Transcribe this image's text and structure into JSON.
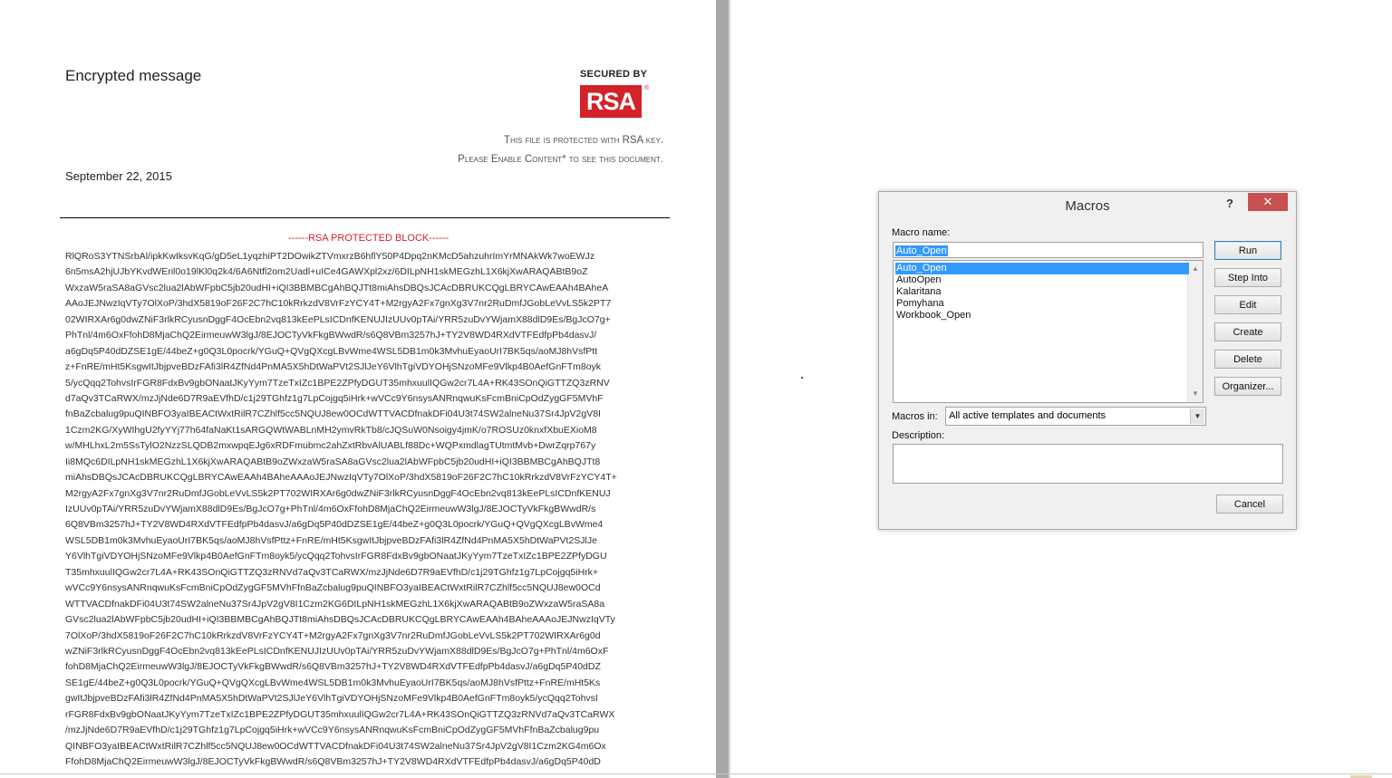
{
  "document": {
    "title": "Encrypted message",
    "secured_by": "SECURED BY",
    "logo_text": "RSA",
    "logo_reg": "®",
    "notice_line1": "This file is protected with RSA key.",
    "notice_line2": "Please Enable Content* to see this document.",
    "date": "September 22, 2015",
    "block_header": "------RSA  PROTECTED  BLOCK------",
    "block_lines": [
      "RlQRoS3YTNSrbAl/ipkKwIksvKqG/gD5eL1yqzhiPT2DOwikZTVmxrzB6hflY50P4Dpq2nKMcD5ahzuhrImYrMNAkWk7woEWJz",
      "6n5msA2hjUJbYKvdWEril0o19lKl0q2k4/6A6Ntfl2om2Uadl+uICe4GAWXpl2xz/6DILpNH1skMEGzhL1X6kjXwARAQABtB9oZ",
      "WxzaW5raSA8aGVsc2lua2lAbWFpbC5jb20udHI+iQI3BBMBCgAhBQJTt8miAhsDBQsJCAcDBRUKCQgLBRYCAwEAAh4BAheA",
      "AAoJEJNwzIqVTy7OlXoP/3hdX5819oF26F2C7hC10kRrkzdV8VrFzYCY4T+M2rgyA2Fx7gnXg3V7nr2RuDmfJGobLeVvLS5k2PT7",
      "02WIRXAr6g0dwZNiF3rlkRCyusnDggF4OcEbn2vq813kEePLsICDnfKENUJIzUUv0pTAi/YRR5zuDvYWjamX88dlD9Es/BgJcO7g+",
      "PhTnl/4m6OxFfohD8MjaChQ2EirmeuwW3lgJ/8EJOCTyVkFkgBWwdR/s6Q8VBm3257hJ+TY2V8WD4RXdVTFEdfpPb4dasvJ/",
      "a6gDq5P40dDZSE1gE/44beZ+g0Q3L0pocrk/YGuQ+QVgQXcgLBvWme4WSL5DB1m0k3MvhuEyaoUrI7BK5qs/aoMJ8hVsfPtt",
      "z+FnRE/mHt5KsgwItJbjpveBDzFAfi3lR4ZfNd4PnMA5X5hDtWaPVt2SJlJeY6VlhTgiVDYOHjSNzoMFe9Vlkp4B0AefGnFTm8oyk",
      "5/ycQqq2TohvsIrFGR8FdxBv9gbONaatJKyYym7TzeTxIZc1BPE2ZPfyDGUT35mhxuulIQGw2cr7L4A+RK43SOnQiGTTZQ3zRNV",
      "d7aQv3TCaRWX/mzJjNde6D7R9aEVfhD/c1j29TGhfz1g7LpCojgq5iHrk+wVCc9Y6nsysANRnqwuKsFcmBniCpOdZygGF5MVhF",
      "fnBaZcbalug9puQINBFO3yaIBEACtWxtRilR7CZhlf5cc5NQUJ8ew0OCdWTTVACDfnakDFi04U3t74SW2alneNu37Sr4JpV2gV8I",
      "1Czm2KG/XyWIhgU2fyYYj77h64faNaKt1sARGQWtWABLnMH2ymvRkTb8/cJQSuW0Nsoigy4jmK/o7ROSUz0knxfXbuEXioM8",
      "w/MHLhxL2m5SsTylO2NzzSLQDB2mxwpqEJg6xRDFmubmc2ahZxtRbvAlUABLf88Dc+WQPxmdlagTUtmtMvb+DwrZqrp767y",
      "Ii8MQc6DILpNH1skMEGzhL1X6kjXwARAQABtB9oZWxzaW5raSA8aGVsc2lua2lAbWFpbC5jb20udHI+iQI3BBMBCgAhBQJTt8",
      "miAhsDBQsJCAcDBRUKCQgLBRYCAwEAAh4BAheAAAoJEJNwzIqVTy7OlXoP/3hdX5819oF26F2C7hC10kRrkzdV8VrFzYCY4T+",
      "M2rgyA2Fx7gnXg3V7nr2RuDmfJGobLeVvLS5k2PT702WIRXAr6g0dwZNiF3rlkRCyusnDggF4OcEbn2vq813kEePLsICDnfKENUJ",
      "IzUUv0pTAi/YRR5zuDvYWjamX88dlD9Es/BgJcO7g+PhTnl/4m6OxFfohD8MjaChQ2EirmeuwW3lgJ/8EJOCTyVkFkgBWwdR/s",
      "6Q8VBm3257hJ+TY2V8WD4RXdVTFEdfpPb4dasvJ/a6gDq5P40dDZSE1gE/44beZ+g0Q3L0pocrk/YGuQ+QVgQXcgLBvWme4",
      "WSL5DB1m0k3MvhuEyaoUrI7BK5qs/aoMJ8hVsfPttz+FnRE/mHt5KsgwItJbjpveBDzFAfi3lR4ZfNd4PnMA5X5hDtWaPVt2SJlJe",
      "Y6VlhTgiVDYOHjSNzoMFe9Vlkp4B0AefGnFTm8oyk5/ycQqq2TohvsIrFGR8FdxBv9gbONaatJKyYym7TzeTxIZc1BPE2ZPfyDGU",
      "T35mhxuulIQGw2cr7L4A+RK43SOnQiGTTZQ3zRNVd7aQv3TCaRWX/mzJjNde6D7R9aEVfhD/c1j29TGhfz1g7LpCojgq5iHrk+",
      "wVCc9Y6nsysANRnqwuKsFcmBniCpOdZygGF5MVhFfnBaZcbalug9puQINBFO3yaIBEACtWxtRilR7CZhlf5cc5NQUJ8ew0OCd",
      "WTTVACDfnakDFi04U3t74SW2alneNu37Sr4JpV2gV8I1Czm2KG6DILpNH1skMEGzhL1X6kjXwARAQABtB9oZWxzaW5raSA8a",
      "GVsc2lua2lAbWFpbC5jb20udHI+iQI3BBMBCgAhBQJTt8miAhsDBQsJCAcDBRUKCQgLBRYCAwEAAh4BAheAAAoJEJNwzIqVTy",
      "7OlXoP/3hdX5819oF26F2C7hC10kRrkzdV8VrFzYCY4T+M2rgyA2Fx7gnXg3V7nr2RuDmfJGobLeVvLS5k2PT702WIRXAr6g0d",
      "wZNiF3rlkRCyusnDggF4OcEbn2vq813kEePLsICDnfKENUJIzUUv0pTAi/YRR5zuDvYWjamX88dlD9Es/BgJcO7g+PhTnl/4m6OxF",
      "fohD8MjaChQ2EirmeuwW3lgJ/8EJOCTyVkFkgBWwdR/s6Q8VBm3257hJ+TY2V8WD4RXdVTFEdfpPb4dasvJ/a6gDq5P40dDZ",
      "SE1gE/44beZ+g0Q3L0pocrk/YGuQ+QVgQXcgLBvWme4WSL5DB1m0k3MvhuEyaoUrI7BK5qs/aoMJ8hVsfPttz+FnRE/mHt5Ks",
      "gwItJbjpveBDzFAfi3lR4ZfNd4PnMA5X5hDtWaPVt2SJlJeY6VlhTgiVDYOHjSNzoMFe9Vlkp4B0AefGnFTm8oyk5/ycQqq2TohvsI",
      "rFGR8FdxBv9gbONaatJKyYym7TzeTxIZc1BPE2ZPfyDGUT35mhxuulIQGw2cr7L4A+RK43SOnQiGTTZQ3zRNVd7aQv3TCaRWX",
      "/mzJjNde6D7R9aEVfhD/c1j29TGhfz1g7LpCojgq5iHrk+wVCc9Y6nsysANRnqwuKsFcmBniCpOdZygGF5MVhFfnBaZcbalug9pu",
      "QINBFO3yaIBEACtWxtRilR7CZhlf5cc5NQUJ8ew0OCdWTTVACDfnakDFi04U3t74SW2alneNu37Sr4JpV2gV8I1Czm2KG4m6Ox",
      "FfohD8MjaChQ2EirmeuwW3lgJ/8EJOCTyVkFkgBWwdR/s6Q8VBm3257hJ+TY2V8WD4RXdVTFEdfpPb4dasvJ/a6gDq5P40dD"
    ]
  },
  "dialog": {
    "title": "Macros",
    "help": "?",
    "close": "✕",
    "macro_name_label": "Macro name:",
    "macro_name_value": "Auto_Open",
    "macros": [
      "Auto_Open",
      "AutoOpen",
      "Kalaritana",
      "Pomyhana",
      "Workbook_Open"
    ],
    "selected_index": 0,
    "buttons": {
      "run": "Run",
      "step_into": "Step Into",
      "edit": "Edit",
      "create": "Create",
      "delete": "Delete",
      "organizer": "Organizer...",
      "cancel": "Cancel"
    },
    "macros_in_label": "Macros in:",
    "macros_in_value": "All active templates and documents",
    "description_label": "Description:"
  },
  "colors": {
    "rsa_red": "#d2232a",
    "selection": "#3399ff",
    "close_red": "#c75050"
  }
}
